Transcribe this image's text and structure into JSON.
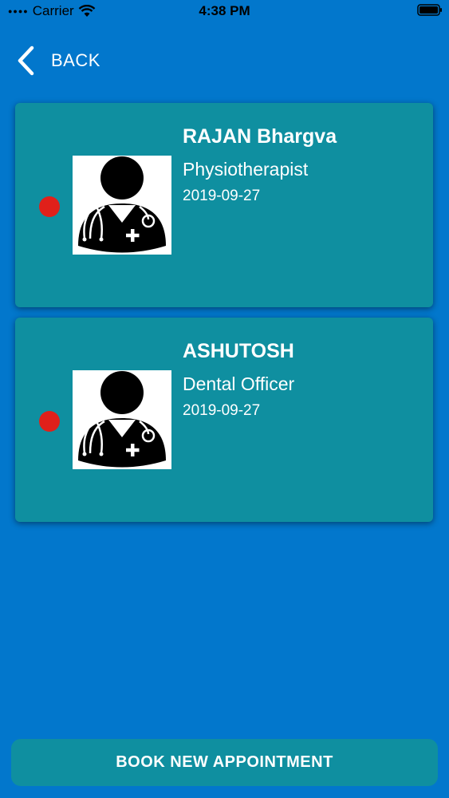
{
  "status_bar": {
    "carrier": "Carrier",
    "time": "4:38 PM",
    "icons": [
      "signal-dots-icon",
      "wifi-icon",
      "battery-icon"
    ]
  },
  "nav": {
    "back_label": "BACK",
    "back_icon": "chevron-left-icon"
  },
  "appointments": [
    {
      "name": "RAJAN Bhargva",
      "role": "Physiotherapist",
      "date": "2019-09-27",
      "status_color": "#e0201a",
      "avatar_icon": "doctor-avatar-icon"
    },
    {
      "name": "ASHUTOSH",
      "role": "Dental Officer",
      "date": "2019-09-27",
      "status_color": "#e0201a",
      "avatar_icon": "doctor-avatar-icon"
    }
  ],
  "footer": {
    "book_label": "BOOK NEW APPOINTMENT"
  },
  "colors": {
    "background": "#0277cc",
    "card": "#0f8fa0",
    "status_dot": "#e0201a",
    "text": "#ffffff"
  }
}
